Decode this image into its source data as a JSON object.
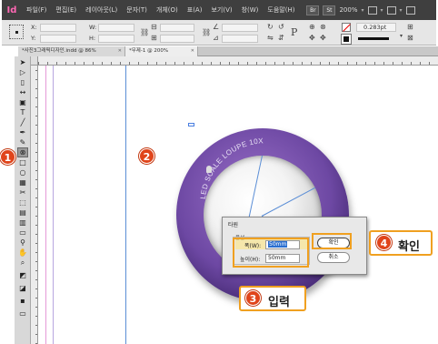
{
  "app": {
    "logo": "Id"
  },
  "menubar": {
    "items": [
      "파일(F)",
      "편집(E)",
      "레이아웃(L)",
      "문자(T)",
      "개체(O)",
      "표(A)",
      "보기(V)",
      "창(W)",
      "도움말(H)"
    ],
    "chip_br": "Br",
    "chip_st": "St",
    "zoom": "200%"
  },
  "controlbar": {
    "x_label": "X:",
    "y_label": "Y:",
    "w_label": "W:",
    "h_label": "H:",
    "stroke_weight": "0.283pt",
    "char_glyph": "P"
  },
  "tabs": [
    {
      "label": "*사진3그래픽디자인.indd @ 86%"
    },
    {
      "label": "*무제-1 @ 200%"
    }
  ],
  "artwork": {
    "arc_text": "LED SCALE LOUPE 10X"
  },
  "dialog": {
    "title": "타원",
    "group_label": "옵션",
    "width_label": "폭(W):",
    "width_value": "50mm",
    "height_label": "높이(H):",
    "height_value": "50mm",
    "ok_label": "확인",
    "cancel_label": "취소"
  },
  "annotations": {
    "step1": "1",
    "step2": "2",
    "step3_num": "3",
    "step3_text": "입력",
    "step4_num": "4",
    "step4_text": "확인"
  },
  "colors": {
    "marker": "#e0441a",
    "highlight": "#f0a020",
    "loupe": "#6d48a3",
    "guide_blue": "#5b8ed6",
    "guide_pink": "#e59ad8"
  }
}
